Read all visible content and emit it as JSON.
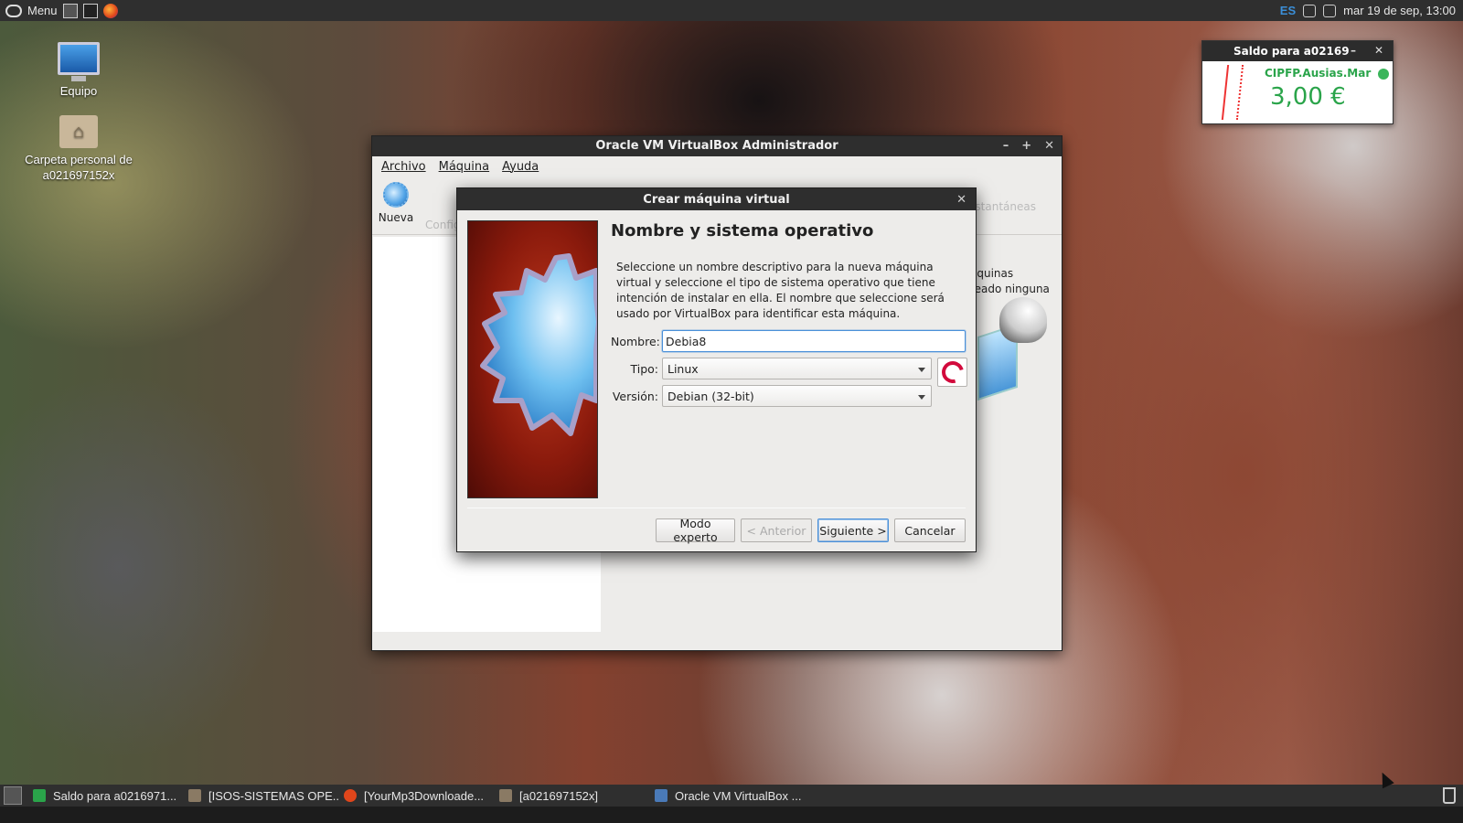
{
  "top_panel": {
    "menu_label": "Menu",
    "language": "ES",
    "clock": "mar 19 de sep, 13:00"
  },
  "desktop": {
    "icons": [
      {
        "label": "Equipo"
      },
      {
        "label": "Carpeta personal de a021697152x"
      }
    ]
  },
  "saldo_widget": {
    "title": "Saldo para a02169",
    "organization": "CIPFP.Ausias.Mar",
    "amount": "3,00 €"
  },
  "vbox_window": {
    "title": "Oracle VM VirtualBox Administrador",
    "menu": [
      "Archivo",
      "Máquina",
      "Ayuda"
    ],
    "toolbar": {
      "new_label": "Nueva",
      "config_label": "Config",
      "snapshots_label": "Instantáneas"
    },
    "welcome_text": [
      "áquinas",
      "reado ninguna"
    ]
  },
  "wizard": {
    "title": "Crear máquina virtual",
    "heading": "Nombre y sistema operativo",
    "description": "Seleccione un nombre descriptivo para la nueva máquina virtual y seleccione el tipo de sistema operativo que tiene intención de instalar en ella. El nombre que seleccione será usado por VirtualBox para identificar esta máquina.",
    "name_label": "Nombre:",
    "name_value": "Debia8",
    "type_label": "Tipo:",
    "type_value": "Linux",
    "version_label": "Versión:",
    "version_value": "Debian (32-bit)",
    "buttons": {
      "expert": "Modo experto",
      "back": "< Anterior",
      "next": "Siguiente >",
      "cancel": "Cancelar"
    }
  },
  "taskbar": {
    "items": [
      {
        "label": "Saldo para a0216971...",
        "icon_color": "#2aa44a"
      },
      {
        "label": "[ISOS-SISTEMAS OPE...",
        "icon_color": "#8a7a64"
      },
      {
        "label": "[YourMp3Downloade...",
        "icon_color": "#e0461b"
      },
      {
        "label": "[a021697152x]",
        "icon_color": "#8a7a64"
      },
      {
        "label": "Oracle VM VirtualBox ...",
        "icon_color": "#4a7ab8"
      }
    ]
  }
}
